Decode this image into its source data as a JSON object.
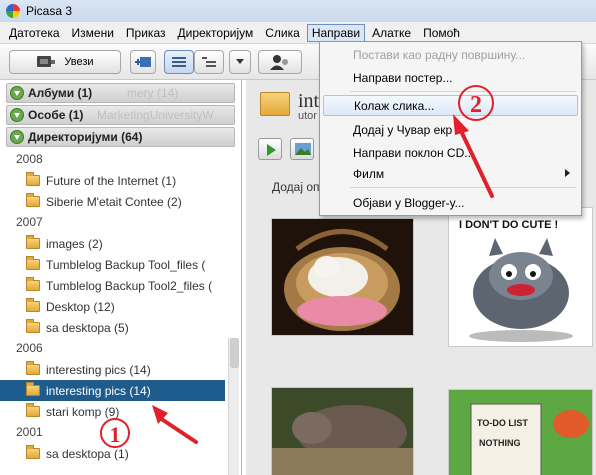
{
  "window": {
    "title": "Picasa 3"
  },
  "menubar": {
    "items": [
      "Датотека",
      "Измени",
      "Приказ",
      "Директоријум",
      "Слика",
      "Направи",
      "Алатке",
      "Помоћ"
    ]
  },
  "toolbar": {
    "import_label": "Увези"
  },
  "left_panel": {
    "sections": [
      {
        "label": "Албуми (1)",
        "ghost": "mery (14)"
      },
      {
        "label": "Особе (1)",
        "ghost": "MarketingUniversityW"
      },
      {
        "label": "Директоријуми (64)"
      }
    ],
    "groups": [
      {
        "year": "2008",
        "folders": [
          "Future of the Internet (1)",
          "Siberie M'etait Contee (2)"
        ]
      },
      {
        "year": "2007",
        "folders": [
          "images (2)",
          "Tumblelog Backup Tool_files (",
          "Tumblelog Backup Tool2_files (",
          "Desktop (12)",
          "sa desktopa (5)"
        ]
      },
      {
        "year": "2006",
        "folders": [
          "interesting pics (14)",
          "interesting pics (14)",
          "stari komp (9)"
        ]
      },
      {
        "year": "2001",
        "folders": [
          "sa desktopa (1)"
        ]
      }
    ],
    "selected_folder": "interesting pics (14)"
  },
  "main": {
    "folder_title": "inte",
    "folder_subtitle": "utor",
    "caption": "Додај оп",
    "thumb_captions": [
      "I DON'T DO CUTE !",
      "TO-DO LIST",
      "NOTHING"
    ]
  },
  "dropdown": {
    "items": [
      {
        "label": "Постави као радну површину...",
        "disabled": true
      },
      {
        "label": "Направи постер..."
      },
      {
        "label": "Колаж слика...",
        "highlighted": true
      },
      {
        "label": "Додај у Чувар екр"
      },
      {
        "label": "Направи поклон CD..."
      },
      {
        "label": "Филм",
        "submenu": true
      },
      {
        "label": "Објави у Blogger-у..."
      }
    ]
  },
  "annotations": {
    "marker_1": "1",
    "marker_2": "2",
    "color": "#e0202a"
  },
  "colors": {
    "selection": "#1e5c8e",
    "menu_open_border": "#6b8fbd"
  }
}
